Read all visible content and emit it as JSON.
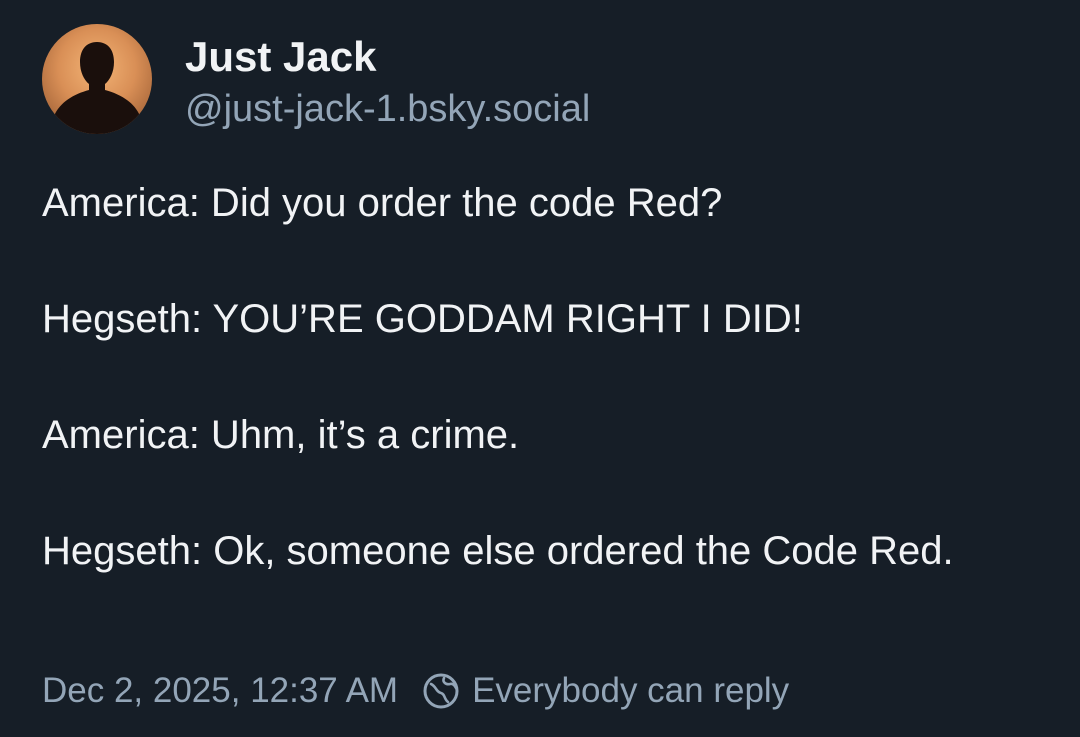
{
  "author": {
    "display_name": "Just Jack",
    "handle": "@just-jack-1.bsky.social",
    "avatar_icon": "user-silhouette-icon"
  },
  "post": {
    "paragraphs": [
      "America: Did you order the code Red?",
      "Hegseth: YOU’RE GODDAM RIGHT I DID!",
      "America: Uhm, it’s a crime.",
      "Hegseth: Ok, someone else ordered the Code Red."
    ]
  },
  "meta": {
    "timestamp": "Dec 2, 2025, 12:37 AM",
    "reply_setting_icon": "globe-icon",
    "reply_setting": "Everybody can reply"
  },
  "colors": {
    "background": "#161e27",
    "text": "#f1f3f5",
    "muted": "#93a5b7",
    "avatar": "#d98f56"
  }
}
